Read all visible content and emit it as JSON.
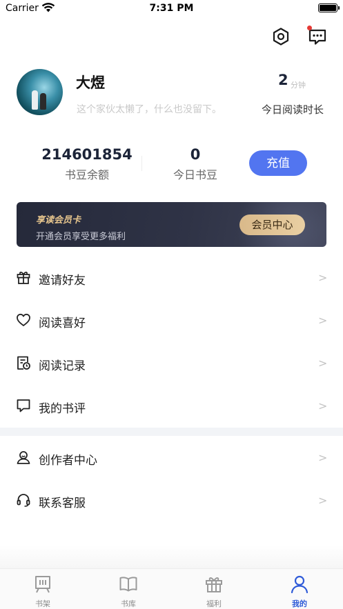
{
  "status_bar": {
    "carrier": "Carrier",
    "time": "7:31 PM"
  },
  "profile": {
    "name": "大煜",
    "bio": "这个家伙太懒了，什么也没留下。",
    "read_time_value": "2",
    "read_time_unit": "分钟",
    "read_time_label": "今日阅读时长"
  },
  "balance": {
    "beans_value": "214601854",
    "beans_label": "书豆余额",
    "today_value": "0",
    "today_label": "今日书豆",
    "recharge_label": "充值"
  },
  "vip": {
    "title": "享读会员卡",
    "subtitle": "开通会员享受更多福利",
    "button_label": "会员中心"
  },
  "menu": [
    {
      "label": "邀请好友",
      "icon": "gift-icon"
    },
    {
      "label": "阅读喜好",
      "icon": "heart-icon"
    },
    {
      "label": "阅读记录",
      "icon": "history-icon"
    },
    {
      "label": "我的书评",
      "icon": "comment-icon"
    },
    {
      "label": "创作者中心",
      "icon": "creator-icon"
    },
    {
      "label": "联系客服",
      "icon": "headset-icon"
    }
  ],
  "chevron": ">",
  "tabbar": {
    "items": [
      {
        "label": "书架",
        "icon": "bookshelf-icon"
      },
      {
        "label": "书库",
        "icon": "book-icon"
      },
      {
        "label": "福利",
        "icon": "gift-icon"
      },
      {
        "label": "我的",
        "icon": "user-icon"
      }
    ],
    "active_index": 3
  },
  "colors": {
    "accent": "#2f5bd8",
    "recharge": "#5275f0",
    "vip_gold": "#e6c58d",
    "unread_dot": "#e53935"
  }
}
